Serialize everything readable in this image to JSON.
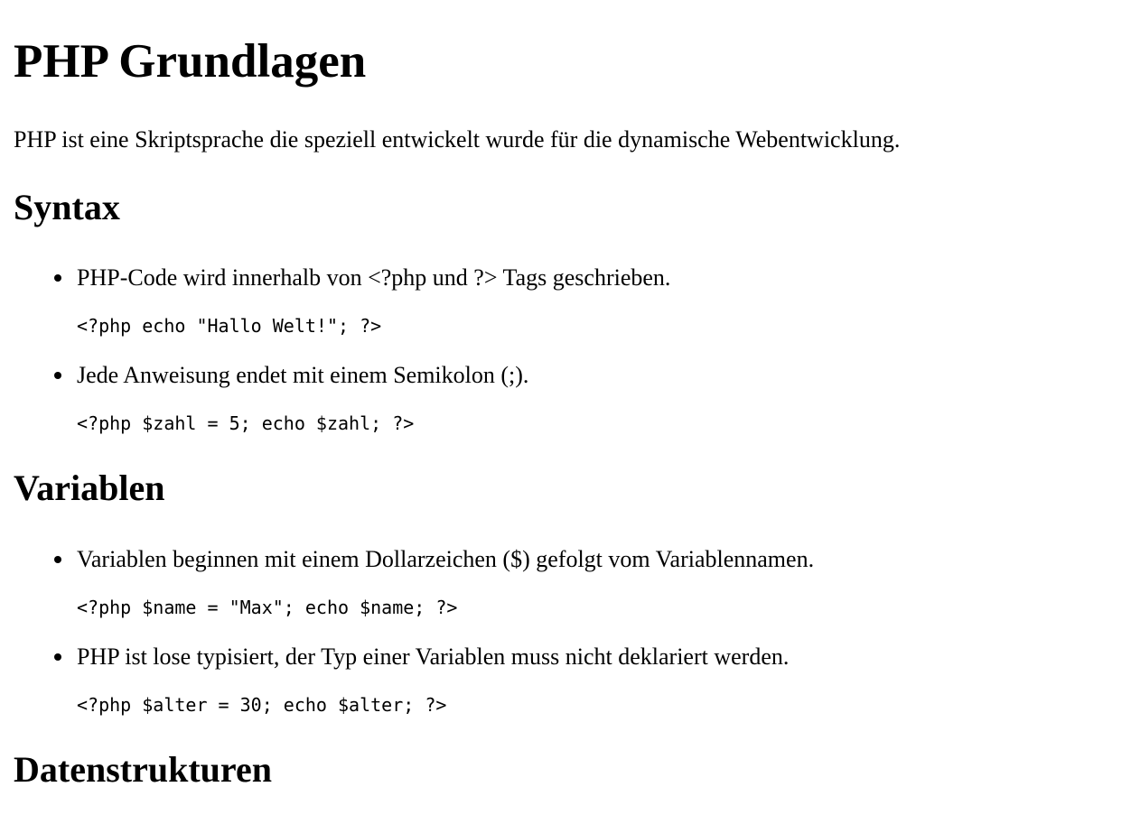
{
  "title": "PHP Grundlagen",
  "intro": "PHP ist eine Skriptsprache die speziell entwickelt wurde für die dynamische Webentwicklung.",
  "sections": [
    {
      "heading": "Syntax",
      "items": [
        {
          "text": "PHP-Code wird innerhalb von <?php und ?> Tags geschrieben.",
          "code": "<?php echo \"Hallo Welt!\"; ?>"
        },
        {
          "text": "Jede Anweisung endet mit einem Semikolon (;).",
          "code": "<?php $zahl = 5; echo $zahl; ?>"
        }
      ]
    },
    {
      "heading": "Variablen",
      "items": [
        {
          "text": "Variablen beginnen mit einem Dollarzeichen ($) gefolgt vom Variablennamen.",
          "code": "<?php $name = \"Max\"; echo $name; ?>"
        },
        {
          "text": "PHP ist lose typisiert, der Typ einer Variablen muss nicht deklariert werden.",
          "code": "<?php $alter = 30; echo $alter; ?>"
        }
      ]
    },
    {
      "heading": "Datenstrukturen",
      "items": []
    }
  ]
}
